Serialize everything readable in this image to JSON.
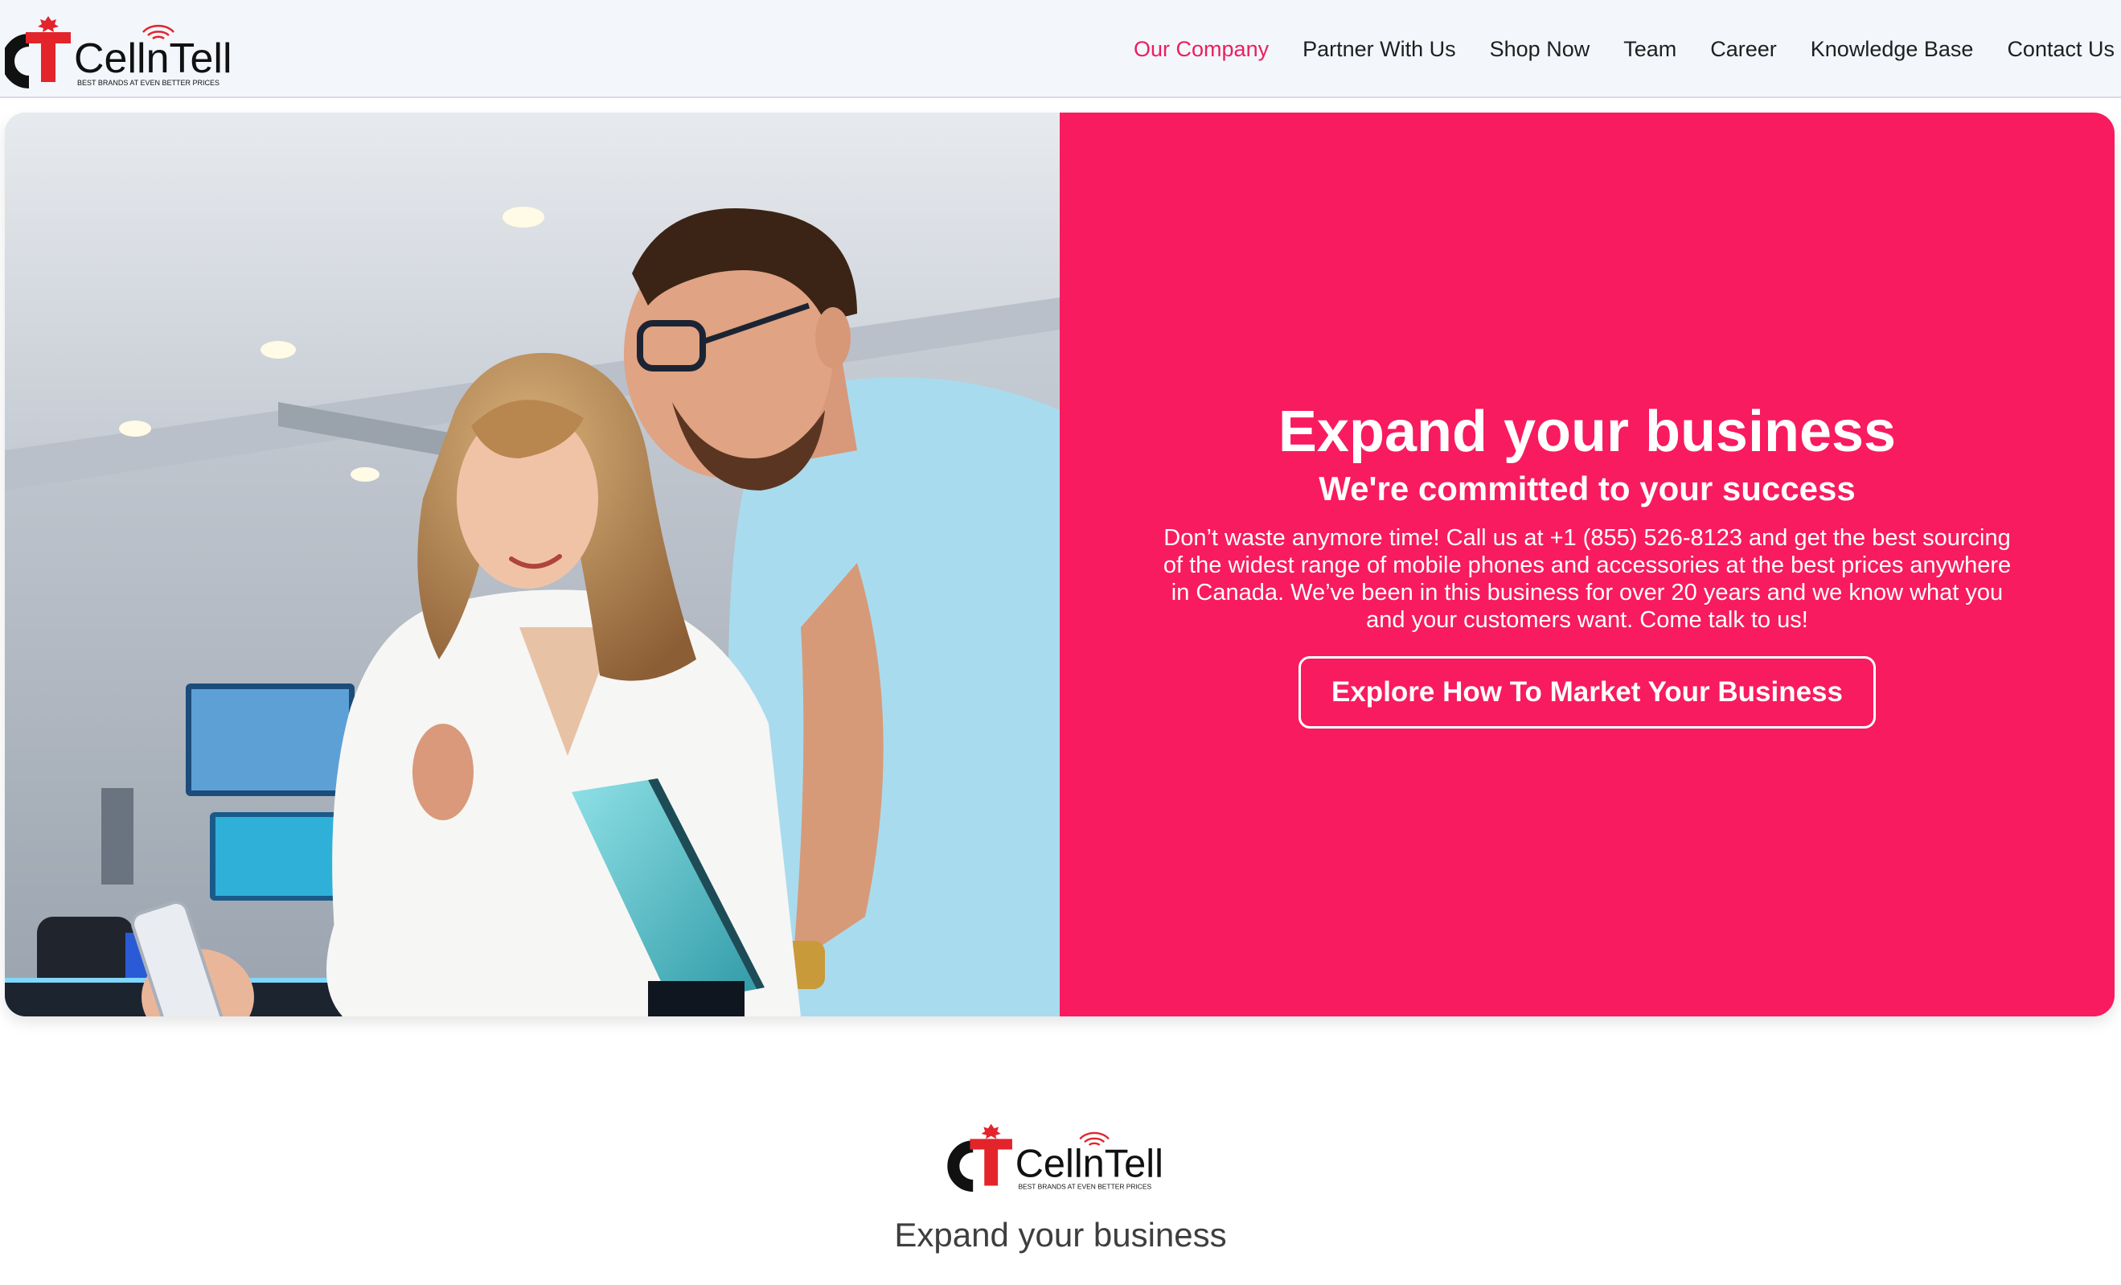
{
  "brand": {
    "name": "CellnTell",
    "tagline": "BEST BRANDS AT EVEN BETTER PRICES",
    "accent_color": "#ea1f5c",
    "panel_color": "#f81b5f"
  },
  "nav": {
    "items": [
      {
        "label": "Our Company",
        "active": true
      },
      {
        "label": "Partner With Us",
        "active": false
      },
      {
        "label": "Shop Now",
        "active": false
      },
      {
        "label": "Team",
        "active": false
      },
      {
        "label": "Career",
        "active": false
      },
      {
        "label": "Knowledge Base",
        "active": false
      },
      {
        "label": "Contact Us",
        "active": false
      }
    ]
  },
  "hero": {
    "title": "Expand your business",
    "subtitle": "We're committed to your success",
    "body": "Don’t waste anymore time! Call us at +1 (855) 526-8123 and get the best sourcing of the widest range of mobile phones and accessories at the best prices anywhere in Canada. We’ve been in this business for over 20 years and we know what you and your customers want. Come talk to us!",
    "cta_label": "Explore How To Market Your Business",
    "image_icon": "couple-shopping-photo"
  },
  "footer": {
    "tagline": "Expand your business"
  }
}
